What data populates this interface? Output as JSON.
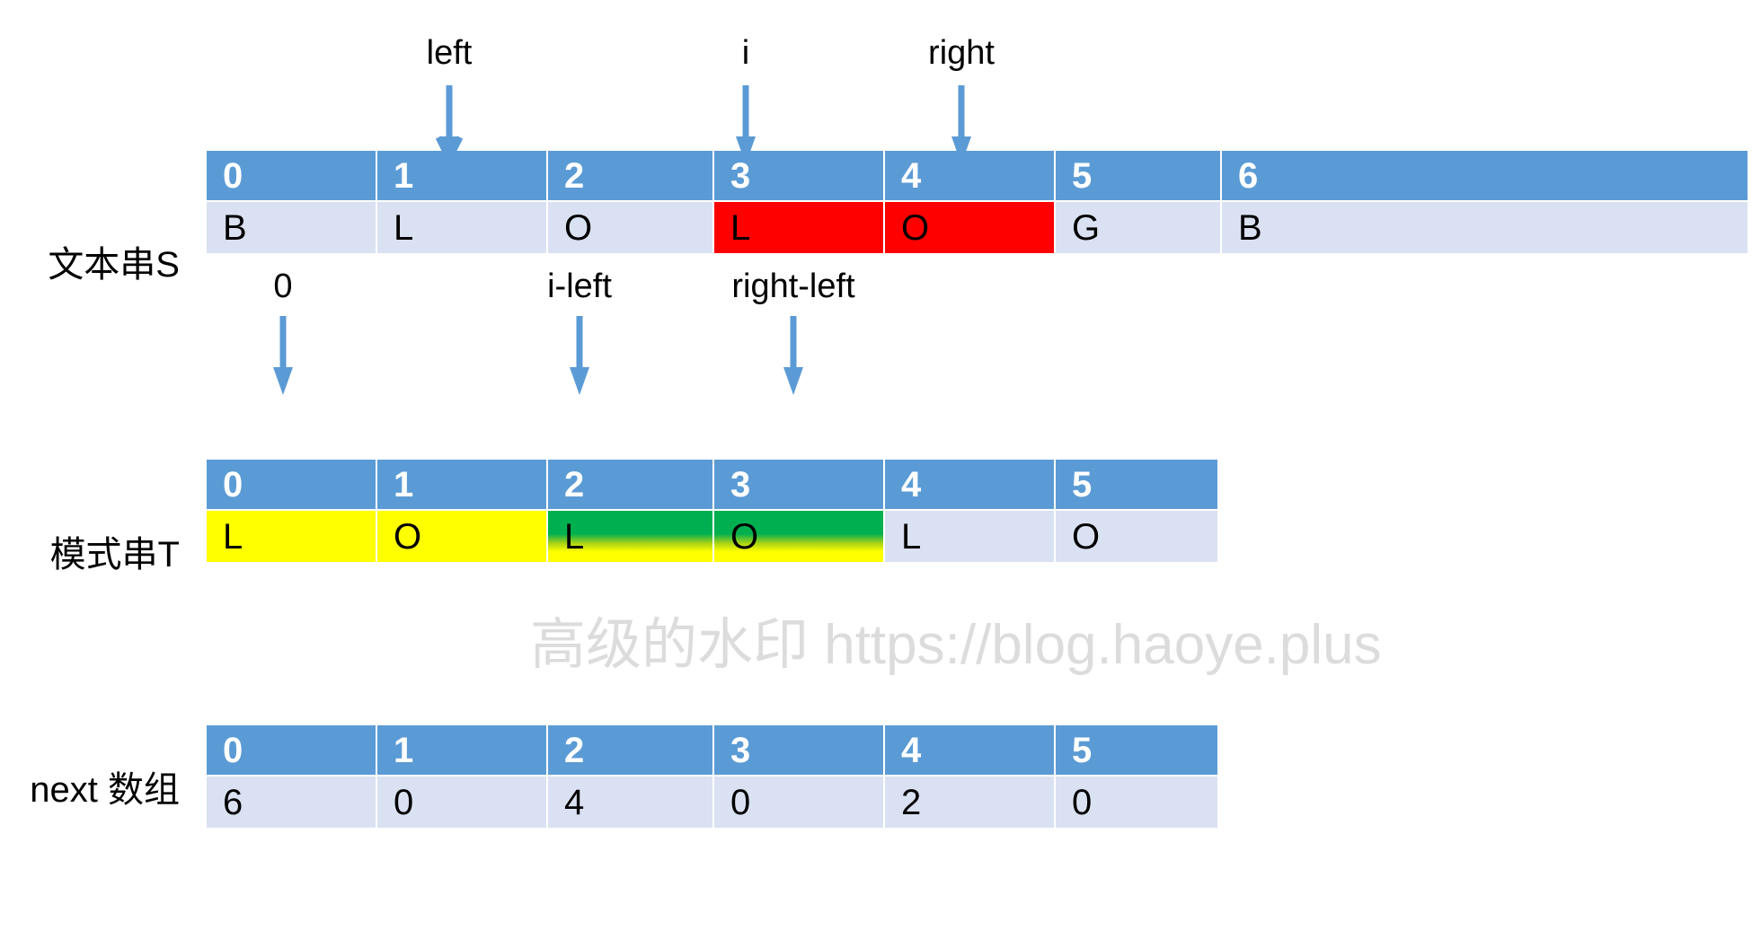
{
  "labels": {
    "text_string": "文本串S",
    "pattern_string": "模式串T",
    "next_array": "next 数组"
  },
  "annotations_top": [
    {
      "name": "left",
      "text": "left"
    },
    {
      "name": "i",
      "text": "i"
    },
    {
      "name": "right",
      "text": "right"
    }
  ],
  "annotations_middle": [
    {
      "name": "zero",
      "text": "0"
    },
    {
      "name": "i-left",
      "text": "i-left"
    },
    {
      "name": "right-left",
      "text": "right-left"
    }
  ],
  "text_string_table": {
    "indices": [
      "0",
      "1",
      "2",
      "3",
      "4",
      "5",
      "6"
    ],
    "values": [
      "B",
      "L",
      "O",
      "L",
      "O",
      "G",
      "B"
    ],
    "highlights": [
      "none",
      "none",
      "none",
      "red",
      "red",
      "none",
      "none"
    ]
  },
  "pattern_string_table": {
    "indices": [
      "0",
      "1",
      "2",
      "3",
      "4",
      "5"
    ],
    "values": [
      "L",
      "O",
      "L",
      "O",
      "L",
      "O"
    ],
    "highlights": [
      "yellow",
      "yellow",
      "green",
      "green",
      "none",
      "none"
    ]
  },
  "next_array_table": {
    "indices": [
      "0",
      "1",
      "2",
      "3",
      "4",
      "5"
    ],
    "values": [
      "6",
      "0",
      "4",
      "0",
      "2",
      "0"
    ]
  },
  "watermark": {
    "text": "高级的水印  https://blog.haoye.plus"
  },
  "colors": {
    "header_blue": "#5B9BD5",
    "cell_blue": "#D9E1F2",
    "highlight_red": "#FF0000",
    "highlight_yellow": "#FFFF00",
    "highlight_green": "#00B050",
    "arrow_blue": "#5B9BD5",
    "watermark_gray": "#DCDCDC"
  }
}
